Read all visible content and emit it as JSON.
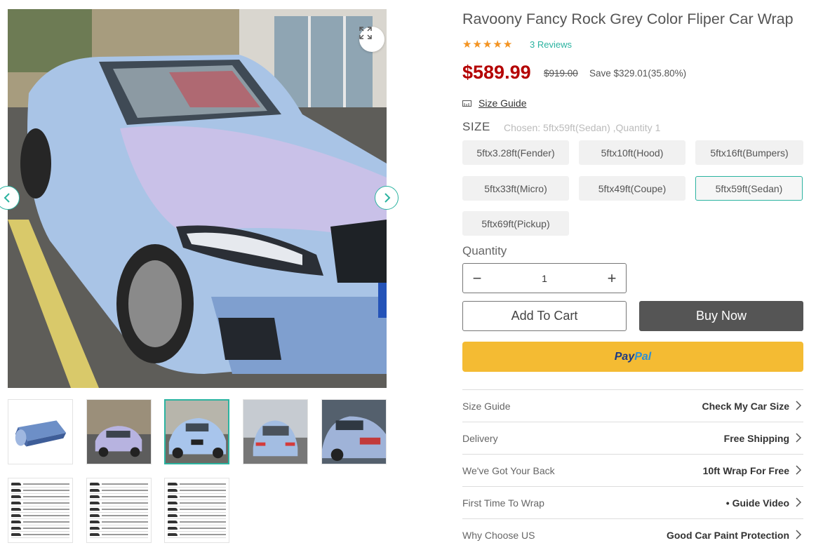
{
  "product": {
    "title": "Ravoony Fancy Rock Grey Color Fliper Car Wrap",
    "rating": 5,
    "reviews_label": "3 Reviews",
    "price": "$589.99",
    "old_price": "$919.00",
    "save_text": "Save $329.01(35.80%)"
  },
  "size_guide": {
    "label": "Size Guide"
  },
  "size": {
    "label": "SIZE",
    "chosen_text": "Chosen: 5ftx59ft(Sedan) ,Quantity 1",
    "options": [
      "5ftx3.28ft(Fender)",
      "5ftx10ft(Hood)",
      "5ftx16ft(Bumpers)",
      "5ftx33ft(Micro)",
      "5ftx49ft(Coupe)",
      "5ftx59ft(Sedan)",
      "5ftx69ft(Pickup)"
    ],
    "selected": "5ftx59ft(Sedan)"
  },
  "quantity": {
    "label": "Quantity",
    "value": "1",
    "minus": "−",
    "plus": "+"
  },
  "actions": {
    "add_to_cart": "Add To Cart",
    "buy_now": "Buy Now",
    "paypal_1": "Pay",
    "paypal_2": "Pal"
  },
  "info_rows": [
    {
      "label": "Size Guide",
      "value": "Check My Car Size"
    },
    {
      "label": "Delivery",
      "value": "Free Shipping"
    },
    {
      "label": "We've Got Your Back",
      "value": "10ft Wrap For Free"
    },
    {
      "label": "First Time To Wrap",
      "value": "• Guide Video"
    },
    {
      "label": "Why Choose US",
      "value": "Good Car Paint Protection"
    }
  ],
  "colors": {
    "accent": "#2bb3a0",
    "price": "#b40000",
    "star": "#f39422",
    "paypal_bg": "#f4bb33",
    "buy_now_bg": "#555555"
  },
  "icons": {
    "zoom": "expand-icon",
    "prev": "chevron-left-icon",
    "next": "chevron-right-icon",
    "ruler": "ruler-icon",
    "row_arrow": "chevron-right-icon"
  }
}
